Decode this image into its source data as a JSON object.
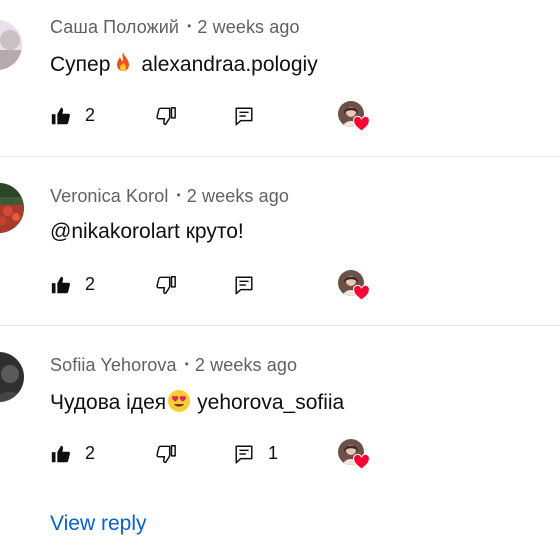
{
  "colors": {
    "link": "#065fd4",
    "meta": "#606060",
    "text": "#0f0f0f",
    "heart": "#ff0033",
    "divider": "#e5e5e5"
  },
  "comments": [
    {
      "author": "Саша Положий",
      "separator": "•",
      "time": "2 weeks ago",
      "text_before": "Супер",
      "emoji": "fire-emoji",
      "text_after": "alexandraa.pologiy",
      "likes": "2",
      "replies": "",
      "creator_heart": true
    },
    {
      "author": "Veronica Korol",
      "separator": "•",
      "time": "2 weeks ago",
      "text_before": "@nikakorolart круто!",
      "emoji": "",
      "text_after": "",
      "likes": "2",
      "replies": "",
      "creator_heart": true
    },
    {
      "author": "Sofiia Yehorova",
      "separator": "•",
      "time": "2 weeks ago",
      "text_before": "Чудова ідея",
      "emoji": "heart-eyes-emoji",
      "text_after": "yehorova_sofiia",
      "likes": "2",
      "replies": "1",
      "creator_heart": true
    }
  ],
  "view_reply_label": "View reply",
  "icons": {
    "like": "thumbs-up-icon",
    "dislike": "thumbs-down-icon",
    "reply": "reply-icon",
    "creator_heart": "creator-heart-icon"
  }
}
